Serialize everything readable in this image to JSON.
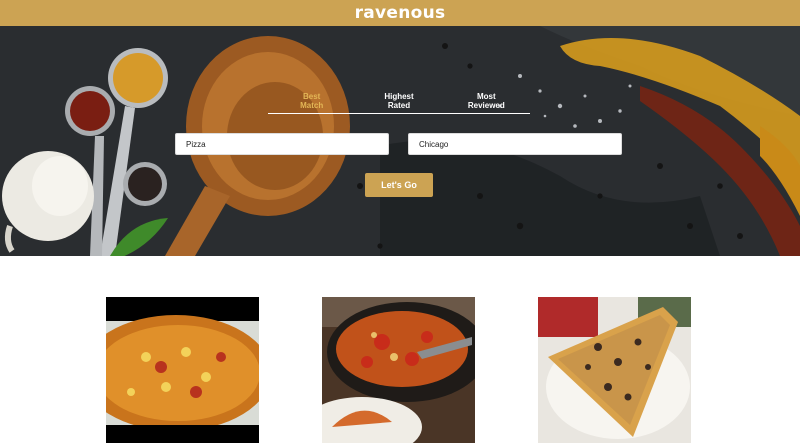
{
  "header": {
    "brand": "ravenous"
  },
  "search": {
    "sort_options": [
      {
        "label_line1": "Best",
        "label_line2": "Match",
        "active": true
      },
      {
        "label_line1": "Highest",
        "label_line2": "Rated",
        "active": false
      },
      {
        "label_line1": "Most",
        "label_line2": "Reviewed",
        "active": false
      }
    ],
    "term_value": "Pizza",
    "location_value": "Chicago",
    "submit_label": "Let's Go"
  },
  "theme": {
    "accent": "#cca353",
    "active_tab": "#e3b656"
  },
  "results": [
    {
      "image": "pizza-photo-1"
    },
    {
      "image": "pizza-photo-2"
    },
    {
      "image": "pizza-photo-3"
    }
  ]
}
